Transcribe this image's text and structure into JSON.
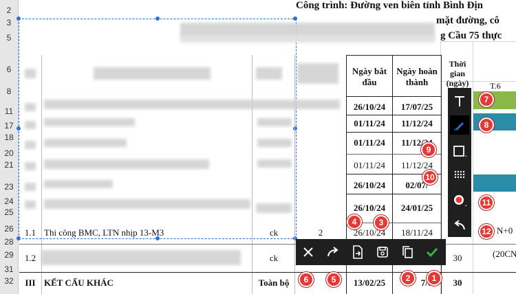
{
  "header": {
    "line1": "Công trình: Đường ven biên tỉnh Bình Địn",
    "line2": "mặt đường, cô",
    "line3": "g Cầu 75 thực"
  },
  "row_numbers": [
    "2",
    "3",
    "5",
    "6",
    "8",
    "11",
    "17",
    "18",
    "20",
    "21",
    "23",
    "24",
    "25",
    "26",
    "28",
    "29",
    "31",
    "32"
  ],
  "columns": {
    "start": "Ngày bắt đầu",
    "end": "Ngày hoàn thành",
    "duration": "Thời gian (ngày)",
    "t6": "T.6"
  },
  "rows": [
    {
      "start": "26/10/24",
      "end": "17/07/25",
      "bold": true
    },
    {
      "start": "01/11/24",
      "end": "11/12/24",
      "bold": true
    },
    {
      "start": "01/11/24",
      "end": "11/12/24",
      "bold": true
    },
    {
      "start": "01/11/24",
      "end": "11/12/24",
      "bold": false
    },
    {
      "start": "26/10/24",
      "end": "02/07/",
      "bold": true
    },
    {
      "start": "26/10/24",
      "end": "24/01/25",
      "bold": true
    },
    {
      "start": "26/10/24",
      "end": "18/11/24",
      "bold": false
    }
  ],
  "row_1_1": {
    "num": "1.1",
    "desc": "Thi công BMC, LTN nhịp 13-M3",
    "unit": "ck",
    "qty": "2"
  },
  "row_12": {
    "num": "1.2",
    "unit": "ck",
    "duration": "30",
    "extra": "(20CN"
  },
  "row_III": {
    "num": "III",
    "desc": "KẾT CẤU KHÁC",
    "unit": "Toàn bộ",
    "start": "13/02/25",
    "end": "7/0",
    "duration": "30"
  },
  "right_note": "N+0",
  "toolbar": {
    "icons": [
      "close-icon",
      "redo-icon",
      "export-icon",
      "save-icon",
      "copy-icon",
      "check-icon"
    ]
  },
  "sidebar": {
    "icons": [
      "text-icon",
      "pen-icon",
      "rectangle-icon",
      "mosaic-icon",
      "record-icon",
      "undo-icon"
    ]
  },
  "badges": [
    "1",
    "2",
    "3",
    "4",
    "5",
    "6",
    "7",
    "8",
    "9",
    "10",
    "11",
    "12"
  ],
  "colors": {
    "selection": "#2f6fd6",
    "toolbar_bg": "#1f1f1f",
    "badge": "#e53935",
    "confirm": "#3cb043",
    "gantt_green": "#8bb84a",
    "gantt_teal": "#2b8ca8"
  }
}
